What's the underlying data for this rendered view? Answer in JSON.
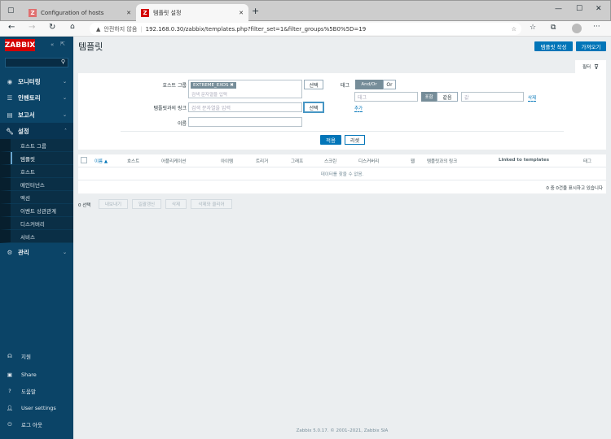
{
  "browser": {
    "tabs": [
      {
        "title": "Configuration of hosts"
      },
      {
        "title": "템플릿 설정"
      }
    ],
    "security": "안전하지 않음",
    "url": "192.168.0.30/zabbix/templates.php?filter_set=1&filter_groups%5B0%5D=19"
  },
  "sidebar": {
    "logo": "ZABBIX",
    "menu": [
      {
        "label": "모니터링"
      },
      {
        "label": "인벤토리"
      },
      {
        "label": "보고서"
      },
      {
        "label": "설정"
      },
      {
        "label": "관리"
      }
    ],
    "submenu": [
      {
        "label": "호스트 그룹"
      },
      {
        "label": "템플릿"
      },
      {
        "label": "호스트"
      },
      {
        "label": "메인터넌스"
      },
      {
        "label": "액션"
      },
      {
        "label": "이벤트 상관관계"
      },
      {
        "label": "디스커버리"
      },
      {
        "label": "서비스"
      }
    ],
    "bottom": [
      {
        "label": "지원"
      },
      {
        "label": "Share"
      },
      {
        "label": "도움말"
      },
      {
        "label": "User settings"
      },
      {
        "label": "로그 아웃"
      }
    ]
  },
  "header": {
    "title": "템플릿",
    "create_button": "템플릿 작성",
    "import_button": "가져오기"
  },
  "filter": {
    "tab_label": "필터",
    "host_group_label": "호스트 그룹",
    "host_group_chip": "EXTREME_EXOS",
    "search_placeholder": "검색 문자열을 입력",
    "select_label": "선택",
    "linked_label": "템플릿과의 링크",
    "name_label": "이름",
    "name_value": "",
    "tags_label": "태그",
    "andor": "And/Or",
    "or": "Or",
    "tag_placeholder": "태그",
    "contains": "포함",
    "equals": "같음",
    "value_placeholder": "값",
    "remove": "삭제",
    "add": "추가",
    "apply": "적용",
    "reset": "리셋"
  },
  "table": {
    "columns": [
      "이름 ▲",
      "호스트",
      "어플리케이션",
      "아이템",
      "트리거",
      "그래프",
      "스크린",
      "디스커버리",
      "웹",
      "템플릿과의 링크",
      "Linked to templates",
      "태그"
    ],
    "empty": "데이터를 찾을 수 없음.",
    "count": "0 중 0건을 표시하고 있습니다"
  },
  "actions": {
    "selected": "0 선택",
    "export": "내보내기",
    "mass_update": "일괄갱신",
    "delete": "삭제",
    "delete_clear": "삭제와 클리어"
  },
  "footer": "Zabbix 5.0.17. © 2001–2021, Zabbix SIA",
  "colors": {
    "sidebar": "#0b4467",
    "primary": "#0275b8",
    "logo": "#d40000"
  }
}
